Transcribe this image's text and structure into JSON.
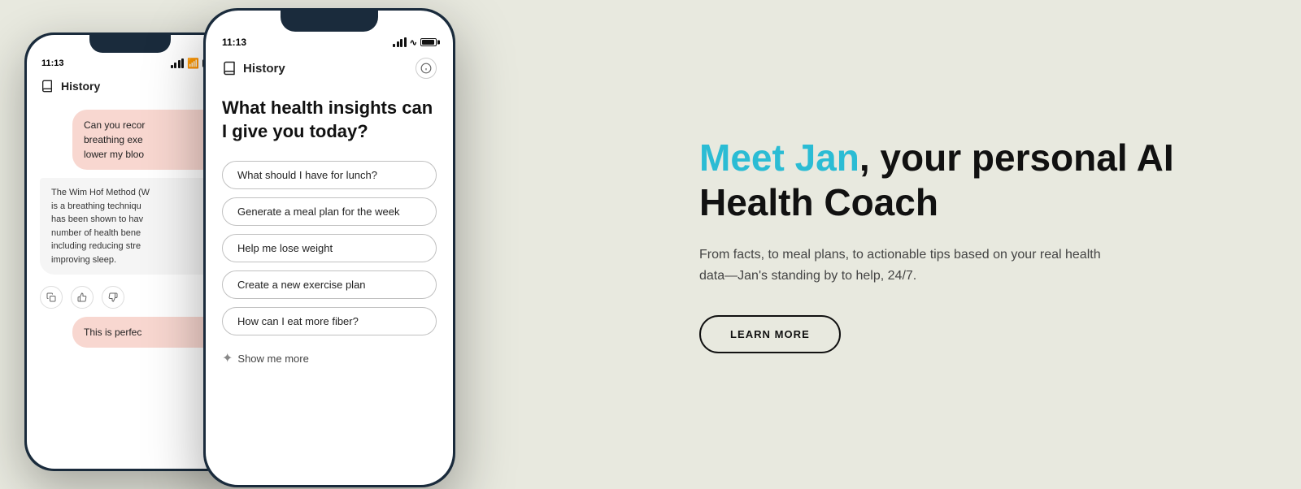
{
  "background_color": "#e8e9df",
  "phones": {
    "back_phone": {
      "time": "11:13",
      "header_label": "History",
      "chat_bubble_1": "Can you recor\nbreathing exe\nlower my bloo",
      "chat_bubble_ai": "The Wim Hof Method (W\nis a breathing techniqu\nhas been shown to hav\nnumber of health bene\nincluding reducing stre\nimproving sleep.",
      "chat_bubble_2": "This is perfec"
    },
    "front_phone": {
      "time": "11:13",
      "header_label": "History",
      "main_question": "What health insights can I give you today?",
      "suggestions": [
        "What should I have for lunch?",
        "Generate a meal plan for the week",
        "Help me lose weight",
        "Create a new exercise plan",
        "How can I eat more fiber?"
      ],
      "show_more_label": "Show me more"
    }
  },
  "text_section": {
    "headline_accent": "Meet Jan",
    "headline_rest": ", your personal AI Health Coach",
    "subtext": "From facts, to meal plans, to actionable tips based on your real health data—Jan's standing by to help, 24/7.",
    "cta_label": "LEARN MORE"
  }
}
